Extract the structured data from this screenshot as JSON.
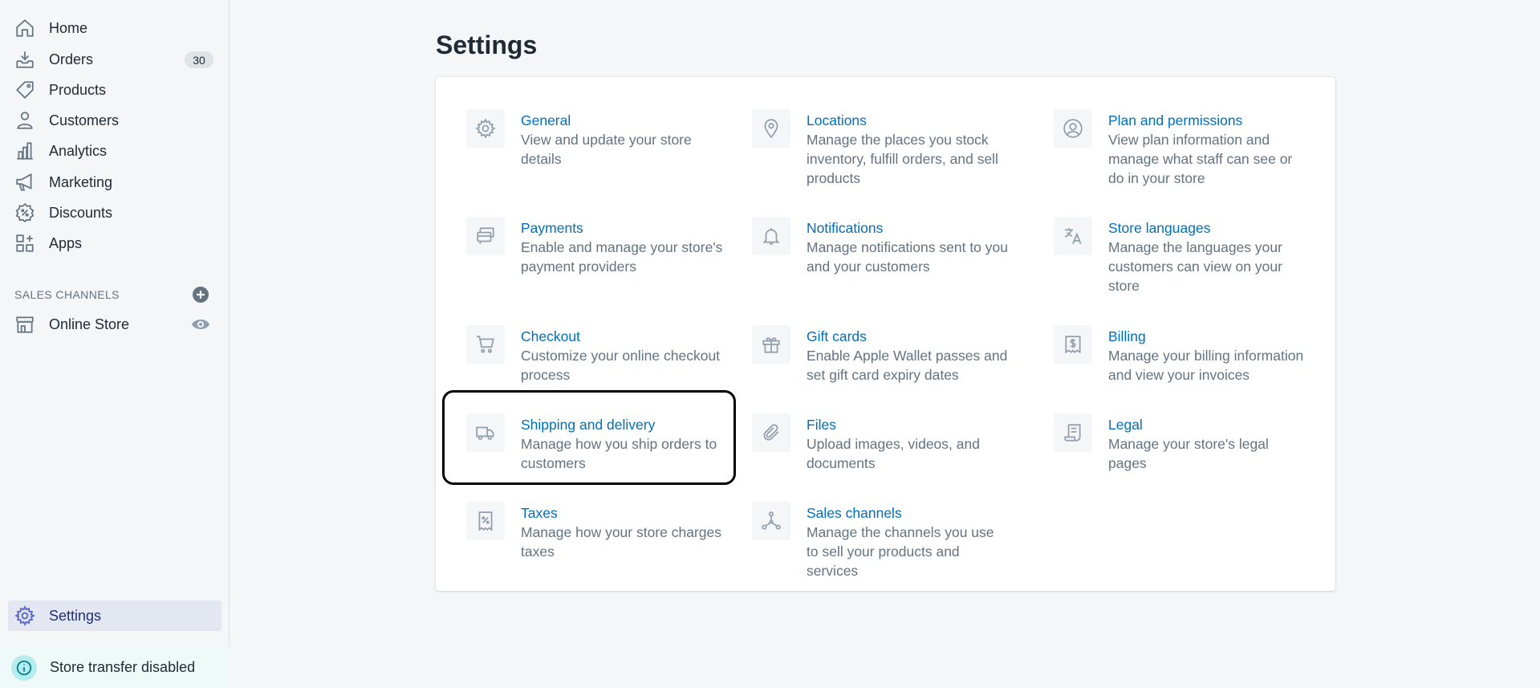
{
  "sidebar": {
    "nav": [
      {
        "label": "Home",
        "icon": "home-icon"
      },
      {
        "label": "Orders",
        "icon": "orders-icon",
        "badge": "30"
      },
      {
        "label": "Products",
        "icon": "tag-icon"
      },
      {
        "label": "Customers",
        "icon": "person-icon"
      },
      {
        "label": "Analytics",
        "icon": "bar-chart-icon"
      },
      {
        "label": "Marketing",
        "icon": "megaphone-icon"
      },
      {
        "label": "Discounts",
        "icon": "discount-icon"
      },
      {
        "label": "Apps",
        "icon": "apps-icon"
      }
    ],
    "sales_channels_title": "SALES CHANNELS",
    "online_store": "Online Store",
    "settings": "Settings",
    "store_transfer": "Store transfer disabled"
  },
  "main": {
    "title": "Settings",
    "tiles": [
      {
        "title": "General",
        "desc": "View and update your store details",
        "icon": "gear-icon"
      },
      {
        "title": "Locations",
        "desc": "Manage the places you stock inventory, fulfill orders, and sell products",
        "icon": "location-pin-icon"
      },
      {
        "title": "Plan and permissions",
        "desc": "View plan information and manage what staff can see or do in your store",
        "icon": "user-circle-icon"
      },
      {
        "title": "Payments",
        "desc": "Enable and manage your store's payment providers",
        "icon": "payments-icon"
      },
      {
        "title": "Notifications",
        "desc": "Manage notifications sent to you and your customers",
        "icon": "bell-icon"
      },
      {
        "title": "Store languages",
        "desc": "Manage the languages your customers can view on your store",
        "icon": "translate-icon"
      },
      {
        "title": "Checkout",
        "desc": "Customize your online checkout process",
        "icon": "cart-icon"
      },
      {
        "title": "Gift cards",
        "desc": "Enable Apple Wallet passes and set gift card expiry dates",
        "icon": "gift-icon"
      },
      {
        "title": "Billing",
        "desc": "Manage your billing information and view your invoices",
        "icon": "billing-icon"
      },
      {
        "title": "Shipping and delivery",
        "desc": "Manage how you ship orders to customers",
        "icon": "truck-icon"
      },
      {
        "title": "Files",
        "desc": "Upload images, videos, and documents",
        "icon": "paperclip-icon"
      },
      {
        "title": "Legal",
        "desc": "Manage your store's legal pages",
        "icon": "legal-icon"
      },
      {
        "title": "Taxes",
        "desc": "Manage how your store charges taxes",
        "icon": "taxes-icon"
      },
      {
        "title": "Sales channels",
        "desc": "Manage the channels you use to sell your products and services",
        "icon": "channels-icon"
      }
    ]
  },
  "colors": {
    "link": "#006fbb",
    "muted": "#637381",
    "active_bg": "#e3e7f1",
    "accent": "#5c6ac4"
  }
}
